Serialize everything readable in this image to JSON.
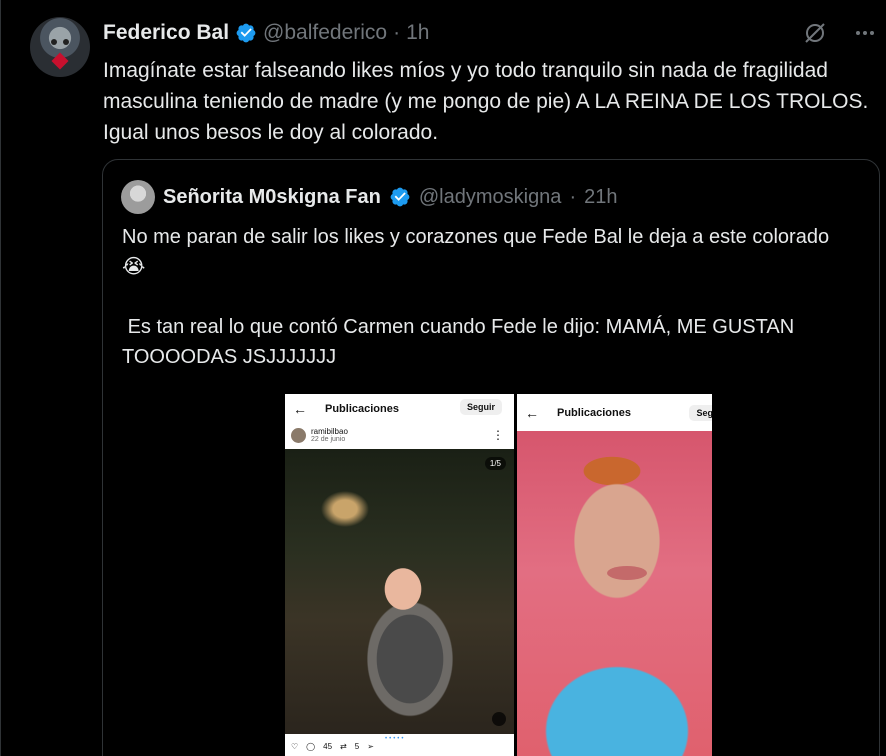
{
  "tweet": {
    "author_name": "Federico Bal",
    "author_handle": "@balfederico",
    "separator": "·",
    "time": "1h",
    "text": "Imagínate estar falseando likes míos y yo todo tranquilo sin nada de fragilidad masculina teniendo de madre (y me pongo de pie) A LA REINA DE LOS TROLOS. Igual unos besos le doy al colorado."
  },
  "quote": {
    "author_name": "Señorita M0skigna Fan",
    "author_handle": "@ladymoskigna",
    "separator": "·",
    "time": "21h",
    "text_line1": "No me paran de salir los likes y corazones que Fede Bal le deja a este colorado😭",
    "text_line2": " Es tan real lo que contó Carmen cuando Fede le dijo: MAMÁ, ME GUSTAN TOOOODAS JSJJJJJJJ"
  },
  "media": {
    "left": {
      "title": "Publicaciones",
      "follow": "Seguir",
      "username": "ramibilbao",
      "date": "22 de junio",
      "counter": "1/5",
      "likes": "45",
      "shares": "5"
    },
    "right": {
      "title": "Publicaciones",
      "follow": "Seg"
    }
  },
  "colors": {
    "verified": "#1d9bf0",
    "muted": "#71767b",
    "text": "#e7e9ea",
    "border": "#2f3336"
  }
}
